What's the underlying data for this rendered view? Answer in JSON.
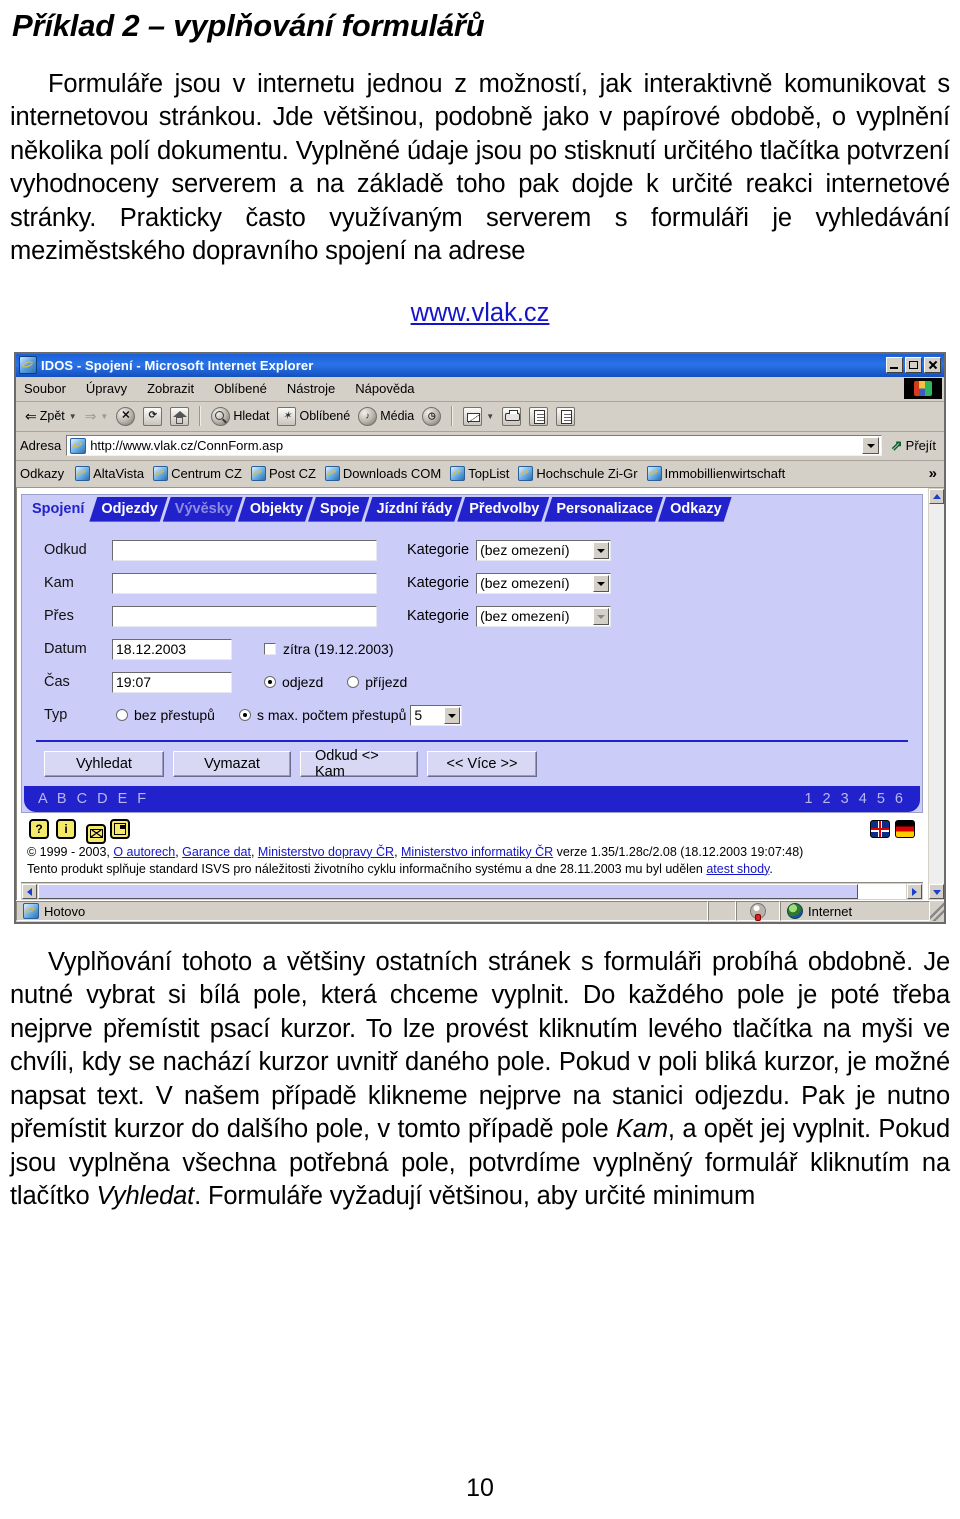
{
  "document": {
    "title": "Příklad 2 – vyplňování formulářů",
    "paragraph_1": "Formuláře jsou v internetu jednou z možností, jak interaktivně komunikovat s internetovou stránkou. Jde většinou, podobně jako v papírové obdobě, o vyplnění několika polí dokumentu. Vyplněné údaje jsou po stisknutí určitého tlačítka potvrzení  vyhodnoceny serverem a na základě toho pak dojde k určité reakci internetové stránky. Prakticky často využívaným serverem s formuláři je vyhledávání meziměstského dopravního spojení na adrese",
    "link": "www.vlak.cz",
    "paragraph_2_a": "Vyplňování tohoto a většiny ostatních stránek s formuláři probíhá obdobně. Je nutné vybrat si bílá pole, která chceme vyplnit. Do každého pole je poté třeba nejprve přemístit psací kurzor. To lze provést kliknutím levého tlačítka na myši ve chvíli, kdy se nachází kurzor uvnitř daného pole. Pokud v poli bliká kurzor, je možné napsat text. V našem případě klikneme nejprve na stanici odjezdu. Pak je nutno přemístit kurzor do dalšího pole, v tomto případě pole ",
    "paragraph_2_em1": "Kam",
    "paragraph_2_b": ", a opět jej vyplnit. Pokud jsou vyplněna všechna potřebná pole, potvrdíme vyplněný formulář kliknutím na tlačítko ",
    "paragraph_2_em2": "Vyhledat",
    "paragraph_2_c": ". Formuláře vyžadují většinou, aby určité minimum",
    "page_number": "10"
  },
  "browser": {
    "title": "IDOS - Spojení - Microsoft Internet Explorer",
    "window_buttons": {
      "minimize": "minimize-icon",
      "maximize": "maximize-icon",
      "close": "close-icon"
    },
    "menu": [
      "Soubor",
      "Úpravy",
      "Zobrazit",
      "Oblíbené",
      "Nástroje",
      "Nápověda"
    ],
    "toolbar": {
      "back": "Zpět",
      "forward": "",
      "stop": "stop-icon",
      "refresh": "refresh-icon",
      "home": "home-icon",
      "search": "Hledat",
      "favorites": "Oblíbené",
      "media": "Média",
      "history": "history-icon",
      "mail": "mail-icon",
      "print": "print-icon",
      "edit": "edit-icon",
      "discuss": "discuss-icon"
    },
    "address": {
      "label": "Adresa",
      "url": "http://www.vlak.cz/ConnForm.asp",
      "go": "Přejít"
    },
    "links": {
      "label": "Odkazy",
      "items": [
        "AltaVista",
        "Centrum CZ",
        "Post CZ",
        "Downloads COM",
        "TopList",
        "Hochschule Zi-Gr",
        "Immobillienwirtschaft"
      ],
      "more": "»"
    },
    "status": {
      "text": "Hotovo",
      "zone": "Internet"
    }
  },
  "idos": {
    "tabs": [
      {
        "label": "Spojení",
        "state": "active"
      },
      {
        "label": "Odjezdy",
        "state": "normal"
      },
      {
        "label": "Vývěsky",
        "state": "disabled"
      },
      {
        "label": "Objekty",
        "state": "normal"
      },
      {
        "label": "Spoje",
        "state": "normal"
      },
      {
        "label": "Jízdní řády",
        "state": "normal"
      },
      {
        "label": "Předvolby",
        "state": "normal"
      },
      {
        "label": "Personalizace",
        "state": "normal"
      },
      {
        "label": "Odkazy",
        "state": "normal"
      }
    ],
    "fields": {
      "odkud_label": "Odkud",
      "odkud_value": "",
      "kam_label": "Kam",
      "kam_value": "",
      "pres_label": "Přes",
      "pres_value": "",
      "kategorie_label": "Kategorie",
      "kategorie_value": "(bez omezení)",
      "datum_label": "Datum",
      "datum_value": "18.12.2003",
      "zitra_label": "zítra (19.12.2003)",
      "cas_label": "Čas",
      "cas_value": "19:07",
      "odjezd_label": "odjezd",
      "prijezd_label": "příjezd",
      "typ_label": "Typ",
      "bez_prestupu_label": "bez přestupů",
      "s_max_label": "s max. počtem přestupů",
      "prestupy_value": "5"
    },
    "buttons": [
      "Vyhledat",
      "Vymazat",
      "Odkud <> Kam",
      "<< Více >>"
    ],
    "alphabar": {
      "letters": "A B C D E F",
      "numbers": "1 2 3 4 5 6"
    },
    "footer_icons": [
      "help-icon",
      "info-icon",
      "mail-icon",
      "save-icon"
    ],
    "flags": [
      "flag-uk-icon",
      "flag-de-icon"
    ],
    "legal_line1_prefix": "© 1999 - 2003, ",
    "legal_links": [
      "O autorech",
      "Garance dat",
      "Ministerstvo dopravy ČR",
      "Ministerstvo informatiky ČR"
    ],
    "legal_line1_suffix": " verze 1.35/1.28c/2.08 (18.12.2003 19:07:48)",
    "legal_line2_prefix": "Tento produkt splňuje standard ISVS pro náležitosti životního cyklu informačního systému a dne 28.11.2003 mu byl udělen ",
    "legal_line2_link": "atest shody",
    "legal_line2_suffix": "."
  },
  "colors": {
    "title_bar": "#1a5fd6",
    "tab_blue": "#2222cc",
    "form_bg": "#ccccf8",
    "link": "#1515c8",
    "chrome": "#d4d0c8"
  }
}
